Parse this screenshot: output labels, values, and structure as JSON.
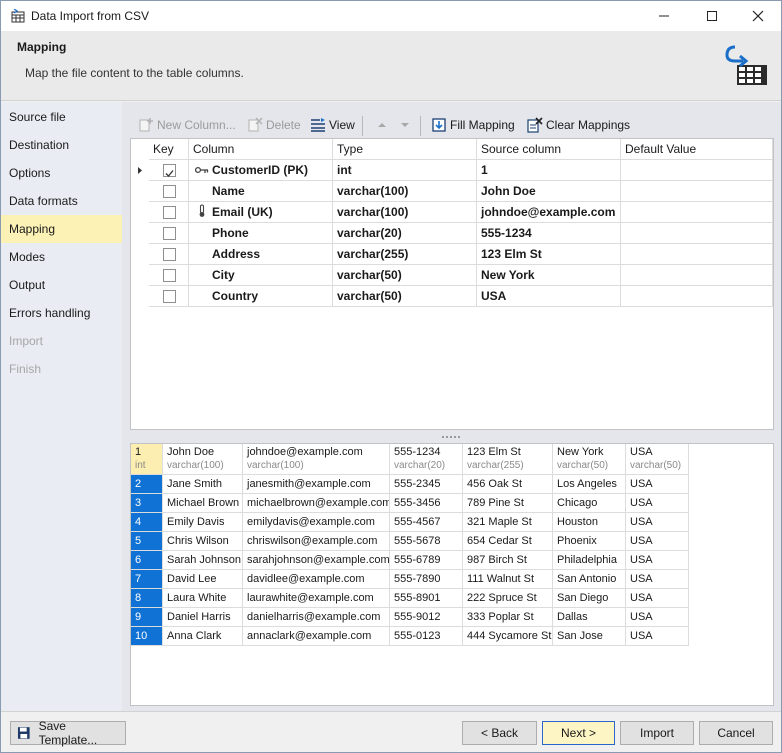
{
  "window": {
    "title": "Data Import from CSV",
    "minimize_icon": "minimize-icon",
    "maximize_icon": "maximize-icon",
    "close_icon": "close-icon"
  },
  "header": {
    "title": "Mapping",
    "subtitle": "Map the file content to the table columns.",
    "icon": "import-table-icon"
  },
  "nav": {
    "items": [
      {
        "label": "Source file",
        "state": "normal"
      },
      {
        "label": "Destination",
        "state": "normal"
      },
      {
        "label": "Options",
        "state": "normal"
      },
      {
        "label": "Data formats",
        "state": "normal"
      },
      {
        "label": "Mapping",
        "state": "selected"
      },
      {
        "label": "Modes",
        "state": "normal"
      },
      {
        "label": "Output",
        "state": "normal"
      },
      {
        "label": "Errors handling",
        "state": "normal"
      },
      {
        "label": "Import",
        "state": "disabled"
      },
      {
        "label": "Finish",
        "state": "disabled"
      }
    ]
  },
  "toolbar": {
    "new_column": "New Column...",
    "delete": "Delete",
    "view": "View",
    "fill_mapping": "Fill Mapping",
    "clear_mappings": "Clear Mappings"
  },
  "mapping": {
    "headers": [
      "Key",
      "Column",
      "Type",
      "Source column",
      "Default Value"
    ],
    "rows": [
      {
        "key": true,
        "icon": "key-icon",
        "column": "CustomerID (PK)",
        "type": "int",
        "source": "1",
        "default": ""
      },
      {
        "key": false,
        "icon": "",
        "column": "Name",
        "type": "varchar(100)",
        "source": "John Doe",
        "default": ""
      },
      {
        "key": false,
        "icon": "thermometer-icon",
        "column": "Email (UK)",
        "type": "varchar(100)",
        "source": "johndoe@example.com",
        "default": ""
      },
      {
        "key": false,
        "icon": "",
        "column": "Phone",
        "type": "varchar(20)",
        "source": "555-1234",
        "default": ""
      },
      {
        "key": false,
        "icon": "",
        "column": "Address",
        "type": "varchar(255)",
        "source": "123 Elm St",
        "default": ""
      },
      {
        "key": false,
        "icon": "",
        "column": "City",
        "type": "varchar(50)",
        "source": "New York",
        "default": ""
      },
      {
        "key": false,
        "icon": "",
        "column": "Country",
        "type": "varchar(50)",
        "source": "USA",
        "default": ""
      }
    ]
  },
  "preview": {
    "headers": [
      {
        "t1": "1",
        "t2": "int"
      },
      {
        "t1": "John Doe",
        "t2": "varchar(100)"
      },
      {
        "t1": "johndoe@example.com",
        "t2": "varchar(100)"
      },
      {
        "t1": "555-1234",
        "t2": "varchar(20)"
      },
      {
        "t1": "123 Elm St",
        "t2": "varchar(255)"
      },
      {
        "t1": "New York",
        "t2": "varchar(50)"
      },
      {
        "t1": "USA",
        "t2": "varchar(50)"
      }
    ],
    "rows": [
      [
        "2",
        "Jane Smith",
        "janesmith@example.com",
        "555-2345",
        "456 Oak St",
        "Los Angeles",
        "USA"
      ],
      [
        "3",
        "Michael Brown",
        "michaelbrown@example.com",
        "555-3456",
        "789 Pine St",
        "Chicago",
        "USA"
      ],
      [
        "4",
        "Emily Davis",
        "emilydavis@example.com",
        "555-4567",
        "321 Maple St",
        "Houston",
        "USA"
      ],
      [
        "5",
        "Chris Wilson",
        "chriswilson@example.com",
        "555-5678",
        "654 Cedar St",
        "Phoenix",
        "USA"
      ],
      [
        "6",
        "Sarah Johnson",
        "sarahjohnson@example.com",
        "555-6789",
        "987 Birch St",
        "Philadelphia",
        "USA"
      ],
      [
        "7",
        "David Lee",
        "davidlee@example.com",
        "555-7890",
        "111 Walnut St",
        "San Antonio",
        "USA"
      ],
      [
        "8",
        "Laura White",
        "laurawhite@example.com",
        "555-8901",
        "222 Spruce St",
        "San Diego",
        "USA"
      ],
      [
        "9",
        "Daniel Harris",
        "danielharris@example.com",
        "555-9012",
        "333 Poplar St",
        "Dallas",
        "USA"
      ],
      [
        "10",
        "Anna Clark",
        "annaclark@example.com",
        "555-0123",
        "444 Sycamore St",
        "San Jose",
        "USA"
      ]
    ]
  },
  "footer": {
    "save_template": "Save Template...",
    "back": "< Back",
    "next": "Next >",
    "import": "Import",
    "cancel": "Cancel"
  }
}
